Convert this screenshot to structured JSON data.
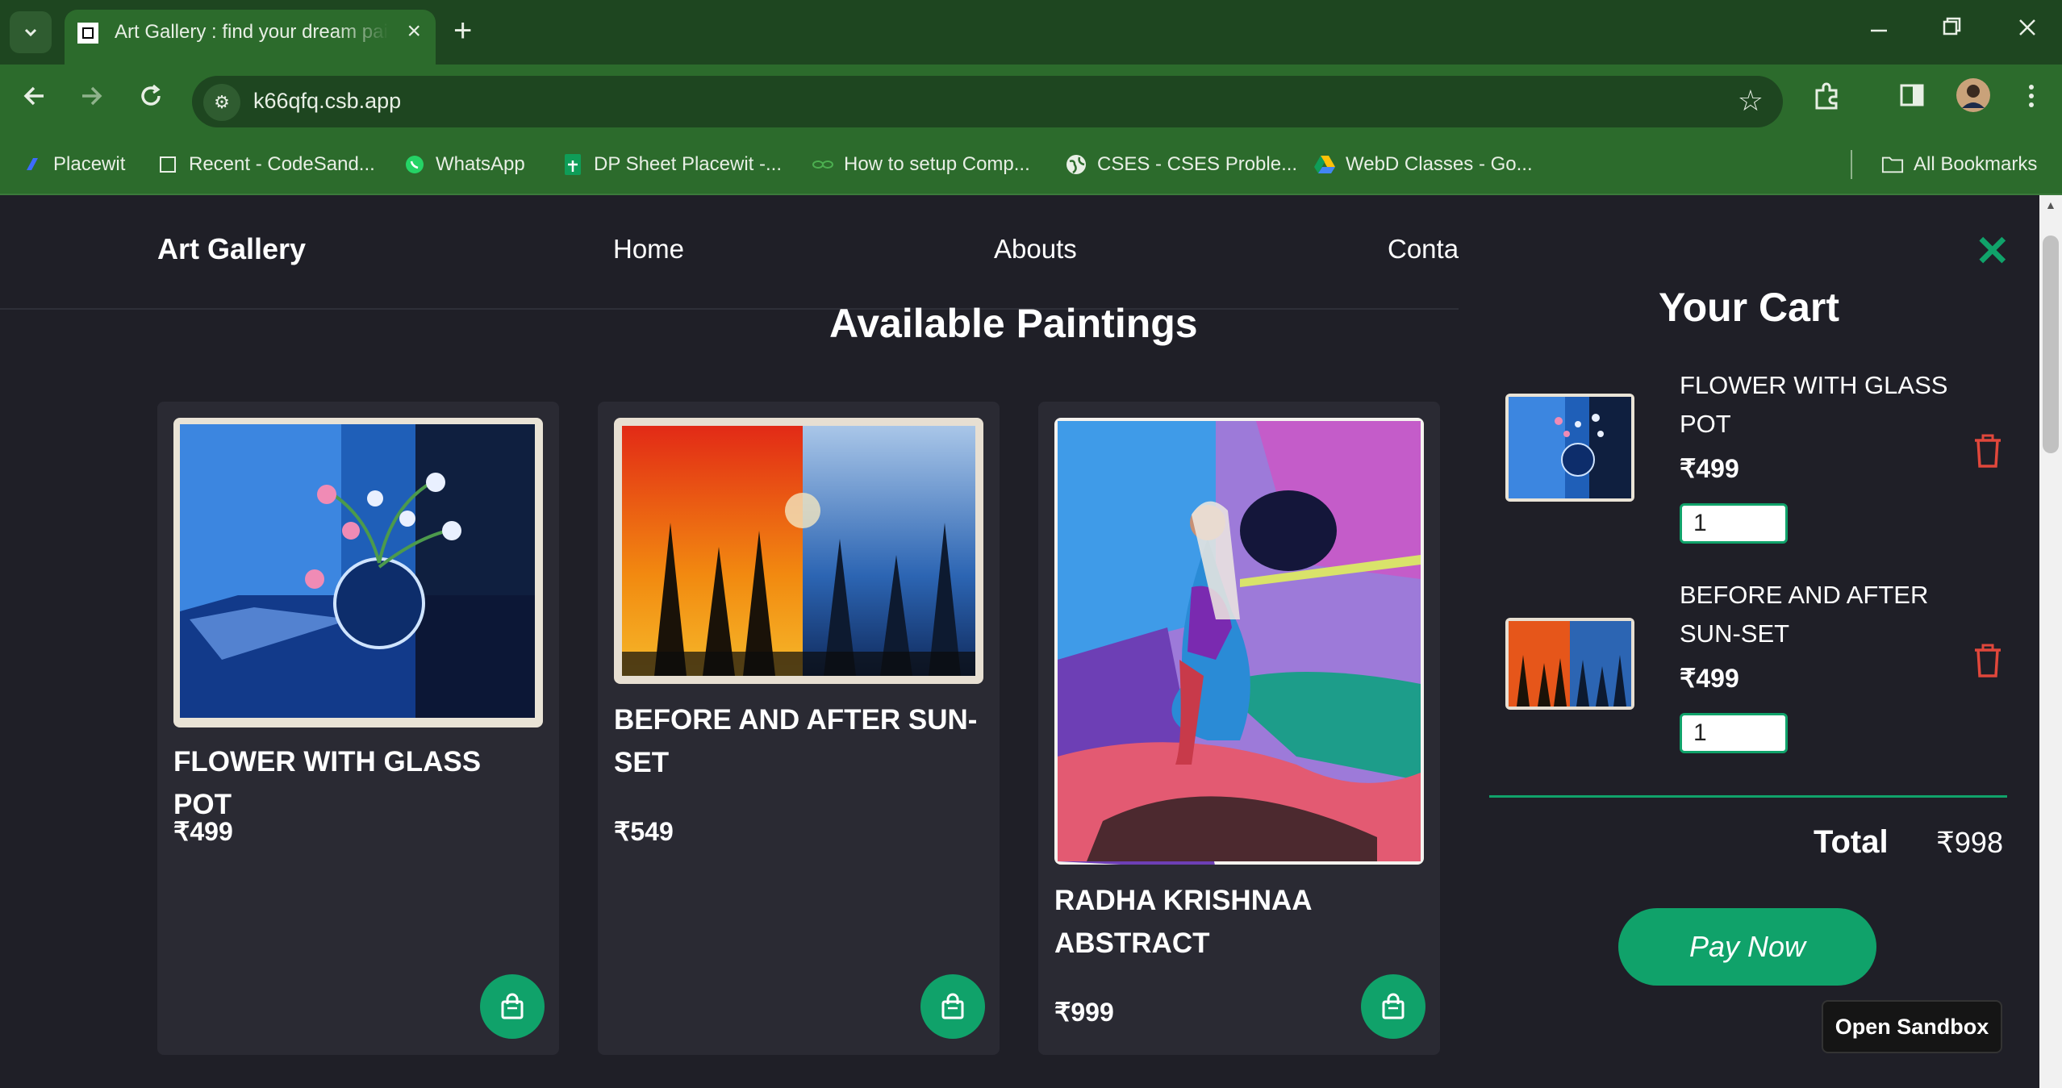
{
  "browser": {
    "tab_title": "Art Gallery : find your dream painting",
    "url": "k66qfq.csb.app",
    "bookmarks": [
      {
        "label": "Placewit",
        "icon": "placewit-icon"
      },
      {
        "label": "Recent - CodeSand...",
        "icon": "page-icon"
      },
      {
        "label": "WhatsApp",
        "icon": "whatsapp-icon"
      },
      {
        "label": "DP Sheet Placewit -...",
        "icon": "sheets-icon"
      },
      {
        "label": "How to setup Comp...",
        "icon": "link-icon"
      },
      {
        "label": "CSES - CSES Proble...",
        "icon": "globe-icon"
      },
      {
        "label": "WebD Classes - Go...",
        "icon": "drive-icon"
      }
    ],
    "all_bookmarks": "All Bookmarks"
  },
  "nav": {
    "brand": "Art Gallery",
    "links": [
      "Home",
      "Abouts",
      "Conta"
    ]
  },
  "section_title": "Available Paintings",
  "paintings": [
    {
      "title": "FLOWER WITH GLASS POT",
      "price": "₹499"
    },
    {
      "title": "BEFORE AND AFTER SUN-SET",
      "price": "₹549"
    },
    {
      "title": "RADHA KRISHNAA ABSTRACT",
      "price": "₹999"
    }
  ],
  "cart": {
    "title": "Your Cart",
    "items": [
      {
        "name": "FLOWER WITH GLASS POT",
        "price": "₹499",
        "qty": "1"
      },
      {
        "name": "BEFORE AND AFTER SUN-SET",
        "price": "₹499",
        "qty": "1"
      }
    ],
    "total_label": "Total",
    "total_value": "₹998",
    "pay_label": "Pay Now"
  },
  "sandbox_label": "Open Sandbox",
  "colors": {
    "accent": "#10a26a",
    "background": "#1f1f27",
    "card": "#2a2a33",
    "chrome": "#2c6b2c",
    "danger": "#e0473b"
  }
}
